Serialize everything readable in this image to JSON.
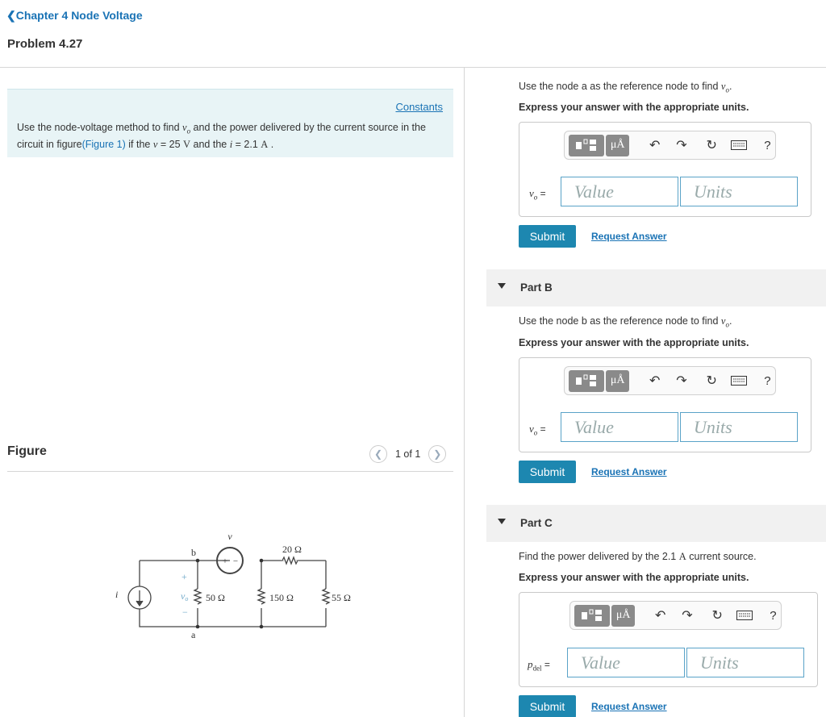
{
  "header": {
    "back_label": "Chapter 4 Node Voltage",
    "problem_title": "Problem 4.27"
  },
  "intro": {
    "constants_label": "Constants",
    "text_1": "Use the node-voltage method to find ",
    "var_vo": "v",
    "var_vo_sub": "o",
    "text_2": " and the power delivered by the current source in the circuit in figure",
    "figure_link": "(Figure 1)",
    "text_3": " if the ",
    "var_v": "v",
    "text_4": " = 25 ",
    "unit_V": "V",
    "text_5": " and the ",
    "var_i": "i",
    "text_6": " = 2.1 ",
    "unit_A": "A",
    "text_7": " ."
  },
  "figure": {
    "label": "Figure",
    "pager": "1 of 1",
    "prev_icon": "chevron-left-icon",
    "next_icon": "chevron-right-icon",
    "circuit": {
      "source_v_label": "v",
      "node_b": "b",
      "node_a": "a",
      "vo_label": "v",
      "vo_sub": "o",
      "i_label": "i",
      "r_series": "20 Ω",
      "r1": "50 Ω",
      "r2": "150 Ω",
      "r3": "55 Ω",
      "plus": "+",
      "minus": "−"
    }
  },
  "toolbar": {
    "templates_icon": "templates-icon",
    "units_label": "μÅ",
    "undo_icon": "undo-icon",
    "redo_icon": "redo-icon",
    "reset_icon": "reset-icon",
    "keyboard_icon": "keyboard-icon",
    "help_label": "?"
  },
  "partA": {
    "q1_text": "Use the node a as the reference node to find ",
    "q1_var": "v",
    "q1_sub": "o",
    "q1_end": ".",
    "q2": "Express your answer with the appropriate units.",
    "var_label": "v",
    "var_sub": "o",
    "eq": " =",
    "value_placeholder": "Value",
    "units_placeholder": "Units",
    "submit": "Submit",
    "request": "Request Answer"
  },
  "partB": {
    "title": "Part B",
    "q1_text": "Use the node b as the reference node to find ",
    "q1_var": "v",
    "q1_sub": "o",
    "q1_end": ".",
    "q2": "Express your answer with the appropriate units.",
    "var_label": "v",
    "var_sub": "o",
    "eq": " =",
    "value_placeholder": "Value",
    "units_placeholder": "Units",
    "submit": "Submit",
    "request": "Request Answer"
  },
  "partC": {
    "title": "Part C",
    "q1_text": "Find the power delivered by the 2.1 ",
    "q1_unit": "A",
    "q1_end": " current source.",
    "q2": "Express your answer with the appropriate units.",
    "var_label": "p",
    "var_sub": "del",
    "eq": " =",
    "value_placeholder": "Value",
    "units_placeholder": "Units",
    "submit": "Submit",
    "request": "Request Answer"
  }
}
